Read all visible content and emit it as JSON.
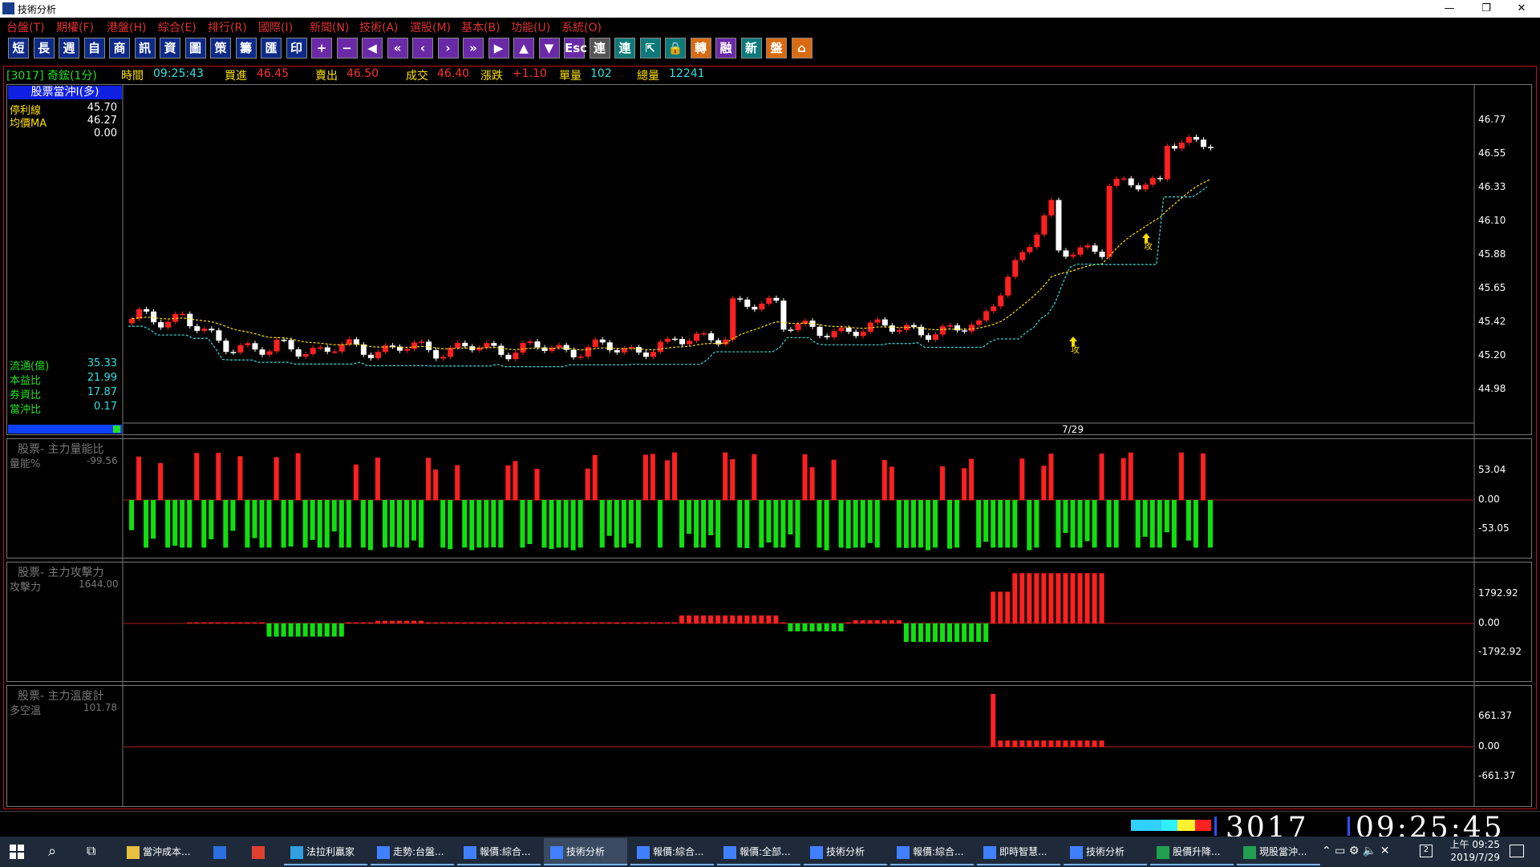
{
  "window": {
    "title": "技術分析",
    "controls": [
      "—",
      "❐",
      "✕"
    ]
  },
  "menu": [
    "台盤(T)",
    "期權(F)",
    "港盤(H)",
    "綜合(E)",
    "排行(R)",
    "國際(I)",
    "新聞(N)",
    "技術(A)",
    "選股(M)",
    "基本(B)",
    "功能(U)",
    "系統(O)"
  ],
  "toolbar": [
    "短",
    "長",
    "週",
    "自",
    "商",
    "訊",
    "資",
    "圖",
    "策",
    "籌",
    "匯",
    "印",
    "+",
    "−",
    "◀",
    "«",
    "‹",
    "›",
    "»",
    "▶",
    "▲",
    "▼",
    "Esc",
    "連",
    "連",
    "⇱",
    "🔒",
    "轉",
    "融",
    "新",
    "盤",
    "⌂"
  ],
  "quote": {
    "symbol": "[3017] 奇鋐(1分)",
    "time_label": "時間",
    "time": "09:25:43",
    "bid_label": "買進",
    "bid": "46.45",
    "ask_label": "賣出",
    "ask": "46.50",
    "last_label": "成交",
    "last": "46.40",
    "change_label": "漲跌",
    "change": "+1.10",
    "vol_label": "單量",
    "vol": "102",
    "total_label": "總量",
    "total": "12241"
  },
  "main_panel": {
    "title": "股票當沖I(多)",
    "indicators": [
      {
        "label": "停利線",
        "value": "45.70"
      },
      {
        "label": "均價MA",
        "value": "46.27"
      },
      {
        "label": "",
        "value": "0.00"
      }
    ],
    "stats": [
      {
        "label": "流通(億)",
        "value": "35.33"
      },
      {
        "label": "本益比",
        "value": "21.99"
      },
      {
        "label": "券資比",
        "value": "17.87"
      },
      {
        "label": "當沖比",
        "value": "0.17"
      }
    ],
    "y_labels": [
      "46.77",
      "46.55",
      "46.33",
      "46.10",
      "45.88",
      "45.65",
      "45.42",
      "45.20",
      "44.98"
    ],
    "date": "7/29",
    "attack_marker": "攻"
  },
  "panel_energy": {
    "title": "股票- 主力量能比",
    "label": "量能%",
    "value": "-99.56",
    "y_labels": [
      "53.04",
      "0.00",
      "-53.05"
    ]
  },
  "panel_attack": {
    "title": "股票- 主力攻擊力",
    "label": "攻擊力",
    "value": "1644.00",
    "y_labels": [
      "1792.92",
      "0.00",
      "-1792.92"
    ]
  },
  "panel_temp": {
    "title": "股票- 主力溫度計",
    "label": "多空溫",
    "value": "101.78",
    "y_labels": [
      "661.37",
      "0.00",
      "-661.37"
    ]
  },
  "statusbar": {
    "symbol": "3017",
    "time": "09:25:45"
  },
  "taskbar": {
    "items": [
      "當沖成本...",
      "",
      "",
      "法拉利贏家",
      "走勢:台盤...",
      "報價:綜合...",
      "技術分析",
      "報價:綜合...",
      "報價:全部...",
      "技術分析",
      "報價:綜合...",
      "即時智慧...",
      "技術分析",
      "股價升降...",
      "現股當沖..."
    ],
    "time": "上午 09:25",
    "date": "2019/7/29"
  },
  "colors": {
    "up": "#ff2020",
    "down": "#10e010",
    "background": "#000000",
    "frame": "#c01010"
  }
}
